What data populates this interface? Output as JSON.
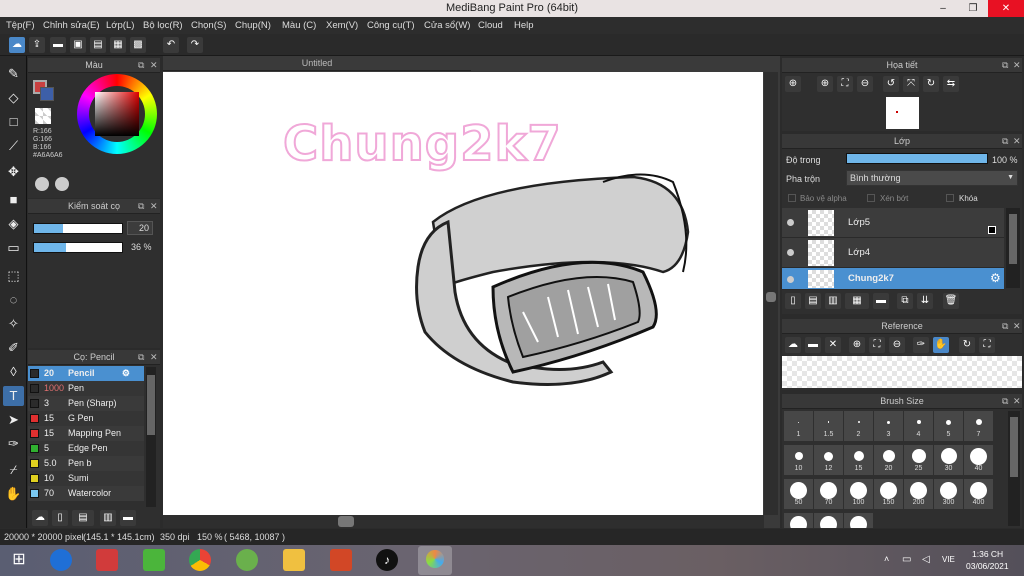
{
  "window": {
    "title": "MediBang Paint Pro (64bit)",
    "minimize": "–",
    "maximize": "❐",
    "close": "✕"
  },
  "menu": [
    "Tệp(F)",
    "Chỉnh sửa(E)",
    "Lớp(L)",
    "Bộ lọc(R)",
    "Chọn(S)",
    "Chụp(N)",
    "Màu (C)",
    "Xem(V)",
    "Công cụ(T)",
    "Cửa sổ(W)",
    "Cloud",
    "Help"
  ],
  "toolbar": {
    "icons": [
      "cloud-icon",
      "share-icon",
      "comment-icon",
      "save-icon",
      "page-icon",
      "pages-icon",
      "grid-icon",
      "undo-icon",
      "redo-icon"
    ]
  },
  "color_panel": {
    "title": "Màu",
    "rgb": {
      "r": "R:166",
      "g": "G:166",
      "b": "B:166"
    },
    "hex": "#A6A6A6"
  },
  "brush_control": {
    "title": "Kiểm soát cọ",
    "size": "20",
    "opacity": "36 %",
    "size_fraction": 0.33,
    "opacity_fraction": 0.36
  },
  "brush_list": {
    "title": "Cọ: Pencil",
    "items": [
      {
        "size": "20",
        "name": "Pencil",
        "color": "#2b2b2b",
        "selected": true
      },
      {
        "size": "1000",
        "name": "Pen",
        "color": "#2b2b2b"
      },
      {
        "size": "3",
        "name": "Pen (Sharp)",
        "color": "#2b2b2b"
      },
      {
        "size": "15",
        "name": "G Pen",
        "color": "#e03030"
      },
      {
        "size": "15",
        "name": "Mapping Pen",
        "color": "#e03030"
      },
      {
        "size": "5",
        "name": "Edge Pen",
        "color": "#30b030"
      },
      {
        "size": "5.0",
        "name": "Pen b",
        "color": "#e0d020"
      },
      {
        "size": "10",
        "name": "Sumi",
        "color": "#e0d020"
      },
      {
        "size": "70",
        "name": "Watercolor",
        "color": "#7ac8f0"
      }
    ]
  },
  "canvas": {
    "tab": "Untitled",
    "text": "Chung2k7"
  },
  "navigator": {
    "title": "Họa tiết"
  },
  "layer_panel": {
    "title": "Lớp",
    "opacity_label": "Độ trong",
    "opacity_value": "100 %",
    "opacity_fraction": 1.0,
    "blend_label": "Pha trộn",
    "blend_value": "Bình thường",
    "protect_alpha": "Bảo vệ alpha",
    "clip": "Xén bớt",
    "lock": "Khóa",
    "layers": [
      {
        "name": "Lớp5",
        "selected": false
      },
      {
        "name": "Lớp4",
        "selected": false
      },
      {
        "name": "Chung2k7",
        "selected": true
      }
    ]
  },
  "reference": {
    "title": "Reference"
  },
  "brush_size": {
    "title": "Brush Size",
    "sizes": [
      "1",
      "1.5",
      "2",
      "3",
      "4",
      "5",
      "7",
      "10",
      "12",
      "15",
      "20",
      "25",
      "30",
      "40",
      "50",
      "70",
      "100",
      "150",
      "200",
      "300",
      "400",
      "",
      "",
      ""
    ]
  },
  "status": {
    "canvas_size": "20000 * 20000 pixel",
    "dimensions": "(145.1 * 145.1cm)",
    "dpi": "350 dpi",
    "zoom": "150 %",
    "coords": "( 5468, 10087 )"
  },
  "taskbar": {
    "lang": "VIE",
    "time": "1:36 CH",
    "date": "03/06/2021"
  }
}
